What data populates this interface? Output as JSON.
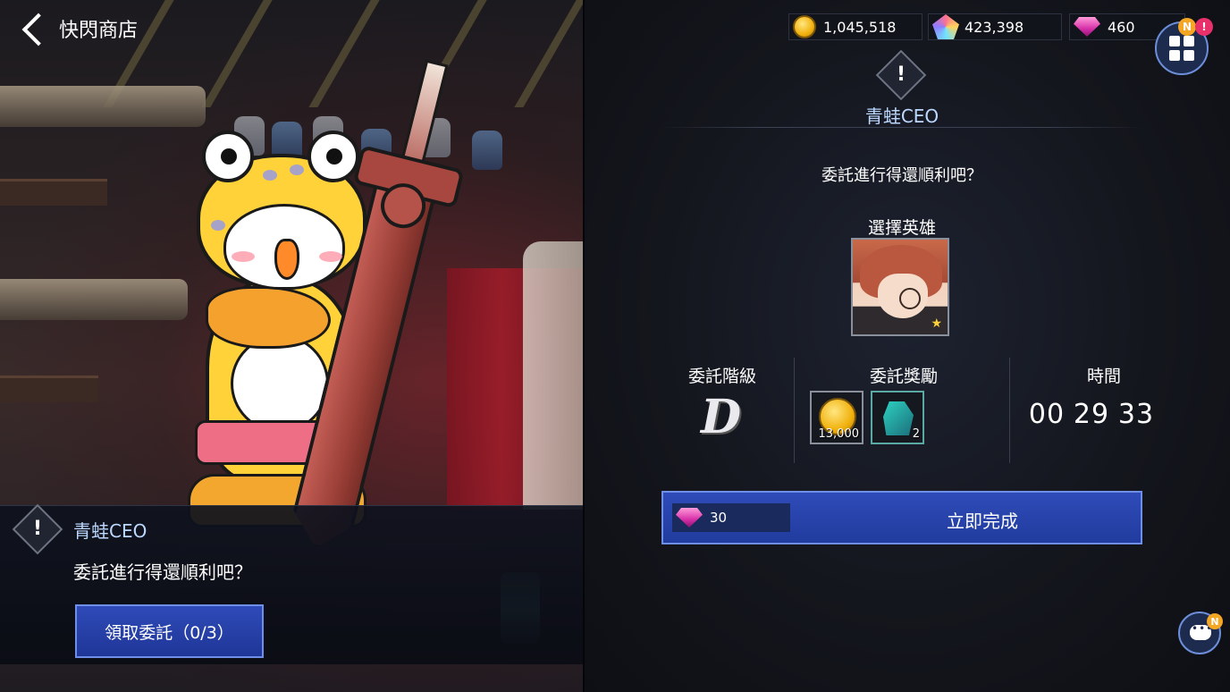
{
  "header": {
    "title": "快閃商店"
  },
  "currencies": {
    "gold": "1,045,518",
    "crystals": "423,398",
    "gems": "460"
  },
  "menu": {
    "badge_new": "N",
    "badge_alert": "!"
  },
  "npc": {
    "name": "青蛙CEO",
    "icon_symbol": "!",
    "dialogue": "委託進行得還順利吧？"
  },
  "left_panel": {
    "accept_button": "領取委託（0/3）"
  },
  "right_panel": {
    "hero_label": "選擇英雄",
    "grade_label": "委託階級",
    "grade_value": "D",
    "reward_label": "委託獎勵",
    "rewards": [
      {
        "icon": "gold-coin-icon",
        "amount": "13,000"
      },
      {
        "icon": "glove-equipment-icon",
        "amount": "2"
      }
    ],
    "time_label": "時間",
    "timer": {
      "hours": "00",
      "minutes": "29",
      "seconds": "33"
    },
    "complete_button": {
      "cost": "30",
      "label": "立即完成"
    }
  },
  "chat": {
    "badge": "N"
  },
  "colors": {
    "button_blue": "#2f4bb8",
    "button_border": "#6f8ee8",
    "name_color": "#bcd8ff",
    "badge_orange": "#f5a623",
    "badge_pink": "#e8306b"
  }
}
